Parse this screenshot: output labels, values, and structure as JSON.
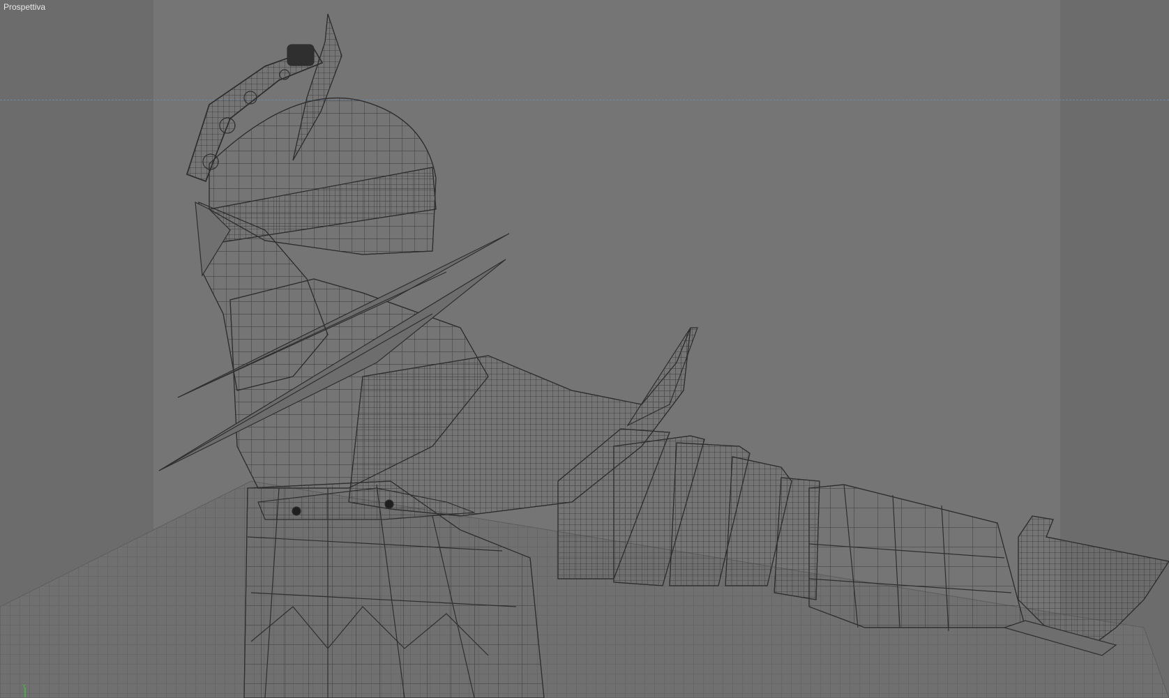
{
  "viewport": {
    "label": "Prospettiva",
    "axis_label": "Y",
    "colors": {
      "background": "#6c6c6c",
      "safe_frame": "#757575",
      "wire": "#2e2e2e",
      "horizon": "#6f88a6",
      "axis_y": "#3fbf3f"
    }
  }
}
